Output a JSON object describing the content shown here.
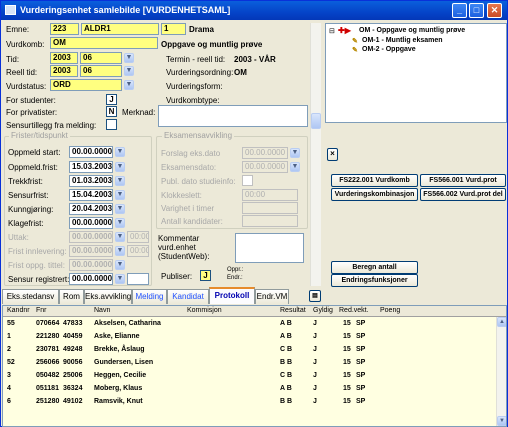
{
  "window": {
    "title": "Vurderingsenhet samlebilde   [VURDENHETSAML]"
  },
  "form": {
    "emne_label": "Emne:",
    "emne_code": "223",
    "emne_id": "ALDR1",
    "emne_ver": "1",
    "emne_name": "Drama",
    "vurdkomb_label": "Vurdkomb:",
    "vurdkomb_code": "OM",
    "vurdkomb_name": "Oppgave og muntlig prøve",
    "tid_label": "Tid:",
    "tid_year": "2003",
    "tid_term": "06",
    "reell_tid_label": "Reell tid:",
    "reell_year": "2003",
    "reell_term": "06",
    "termin_label": "Termin - reell tid:",
    "termin_value": "2003  - VÅR",
    "vurdstatus_label": "Vurdstatus:",
    "vurdstatus_value": "ORD",
    "vurdordning_label": "Vurderingsordning:",
    "vurdordning_value": "OM",
    "vurdform_label": "Vurderingsform:",
    "vurdkombtype_label": "Vurdkombtype:",
    "for_studenter_label": "For studenter:",
    "for_studenter_value": "J",
    "for_privatister_label": "For privatister:",
    "for_privatister_value": "N",
    "merknad_label": "Merknad:",
    "sensurtillegg_label": "Sensurtillegg fra melding:"
  },
  "frister": {
    "title": "Frister/tidspunkt",
    "rows": [
      {
        "label": "Oppmeld start:",
        "value": "00.00.0000",
        "disabled": false
      },
      {
        "label": "Oppmeld.frist:",
        "value": "15.03.2003",
        "disabled": false
      },
      {
        "label": "Trekkfrist:",
        "value": "01.03.2003",
        "disabled": false
      },
      {
        "label": "Sensurfrist:",
        "value": "15.04.2003",
        "disabled": false
      },
      {
        "label": "Kunngjøring:",
        "value": "20.04.2003",
        "disabled": false
      },
      {
        "label": "Klagefrist:",
        "value": "00.00.0000",
        "disabled": false
      },
      {
        "label": "Uttak:",
        "value": "00.00.0000",
        "disabled": true,
        "time": "00:00"
      },
      {
        "label": "Frist innlevering:",
        "value": "00.00.0000",
        "disabled": true,
        "time": "00:00"
      },
      {
        "label": "Frist oppg. tittel:",
        "value": "00.00.0000",
        "disabled": true
      },
      {
        "label": "Sensur registrert:",
        "value": "00.00.0000",
        "disabled": false
      }
    ]
  },
  "eksamen": {
    "title": "Eksamensavvikling",
    "forslag_label": "Forslag eks.dato",
    "forslag_value": "00.00.0000",
    "eksamensdato_label": "Eksamensdato:",
    "eksamensdato_value": "00.00.0000",
    "publ_label": "Publ. dato studieinfo:",
    "klokkeslett_label": "Klokkeslett:",
    "klokkeslett_value": "00:00",
    "varighet_label": "Varighet i timer",
    "antall_label": "Antall kandidater:",
    "kommentar_label": "Kommentar vurd.enhet (StudentWeb):",
    "publiser_label": "Publiser:",
    "publiser_value": "J",
    "oppr_label": "Oppr.:",
    "endr_label": "Endr.:"
  },
  "tree": {
    "root": "OM - Oppgave og muntlig prøve",
    "children": [
      "OM-1 - Muntlig eksamen",
      "OM-2 - Oppgave"
    ]
  },
  "buttons": {
    "fs222": "FS222.001 Vurdkomb",
    "fs566_1": "FS566.001 Vurd.prot",
    "vurdkomb": "Vurderingskombinasjon",
    "fs566_2": "FS566.002 Vurd.prot del",
    "beregn": "Beregn antall",
    "endring": "Endringsfunksjoner",
    "small_x": "×"
  },
  "tabs": [
    "Eks.stedansv",
    "Rom",
    "Eks.avvikling",
    "Melding",
    "Kandidat",
    "Protokoll",
    "Endr.VM"
  ],
  "table": {
    "headers": [
      "Kandnr",
      "Fnr",
      "",
      "Navn",
      "Kommisjon",
      "Resultat",
      "Gyldig",
      "Red.vekt.",
      "",
      "Poeng"
    ],
    "rows": [
      [
        "55",
        "070664",
        "47833",
        "Akselsen, Catharina",
        "",
        "A B",
        "J",
        "15",
        "SP",
        ""
      ],
      [
        "1",
        "221280",
        "40459",
        "Aske, Elianne",
        "",
        "A B",
        "J",
        "15",
        "SP",
        ""
      ],
      [
        "2",
        "230781",
        "49248",
        "Brekke, Åslaug",
        "",
        "C B",
        "J",
        "15",
        "SP",
        ""
      ],
      [
        "52",
        "256066",
        "90056",
        "Gundersen, Lisen",
        "",
        "B B",
        "J",
        "15",
        "SP",
        ""
      ],
      [
        "3",
        "050482",
        "25006",
        "Heggen, Cecilie",
        "",
        "C B",
        "J",
        "15",
        "SP",
        ""
      ],
      [
        "4",
        "051181",
        "36324",
        "Moberg, Klaus",
        "",
        "A B",
        "J",
        "15",
        "SP",
        ""
      ],
      [
        "6",
        "251280",
        "49102",
        "Ramsvik, Knut",
        "",
        "B B",
        "J",
        "15",
        "SP",
        ""
      ]
    ]
  }
}
